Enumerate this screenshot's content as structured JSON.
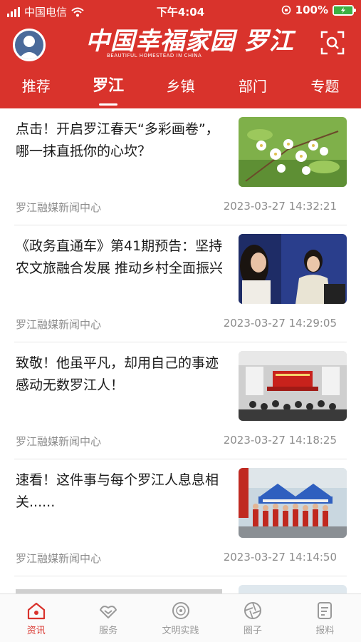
{
  "status_bar": {
    "carrier": "中国电信",
    "time": "下午4:04",
    "battery": "100%"
  },
  "header": {
    "logo_main": "中国幸福家园 罗江",
    "logo_sub": "BEAUTIFUL HOMESTEAD IN CHINA",
    "avatar_icon": "user-avatar-icon",
    "scan_icon": "scan-icon"
  },
  "nav": {
    "tabs": [
      {
        "label": "推荐"
      },
      {
        "label": "罗江",
        "active": true
      },
      {
        "label": "乡镇"
      },
      {
        "label": "部门"
      },
      {
        "label": "专题"
      }
    ]
  },
  "feed": {
    "items": [
      {
        "title": "点击！开启罗江春天“多彩画卷”，哪一抹直抵你的心坎？",
        "source": "罗江融媒新闻中心",
        "time": "2023-03-27 14:32:21",
        "thumb": "white-flowers-photo"
      },
      {
        "title": "《政务直通车》第41期预告：坚持农文旅融合发展 推动乡村全面振兴",
        "source": "罗江融媒新闻中心",
        "time": "2023-03-27 14:29:05",
        "thumb": "interview-photo"
      },
      {
        "title": "致敬！他虽平凡，却用自己的事迹感动无数罗江人！",
        "source": "罗江融媒新闻中心",
        "time": "2023-03-27 14:18:25",
        "thumb": "meeting-hall-photo"
      },
      {
        "title": "速看！这件事与每个罗江人息息相关......",
        "source": "罗江融媒新闻中心",
        "time": "2023-03-27 14:14:50",
        "thumb": "outdoor-event-photo"
      }
    ]
  },
  "tabbar": {
    "tabs": [
      {
        "label": "资讯",
        "icon": "home-icon",
        "active": true
      },
      {
        "label": "服务",
        "icon": "handshake-icon"
      },
      {
        "label": "文明实践",
        "icon": "emblem-icon"
      },
      {
        "label": "圈子",
        "icon": "aperture-icon"
      },
      {
        "label": "报料",
        "icon": "report-icon"
      }
    ]
  },
  "colors": {
    "brand_red": "#d9332c",
    "meta_gray": "#8c8c8c",
    "tab_gray": "#999999"
  }
}
